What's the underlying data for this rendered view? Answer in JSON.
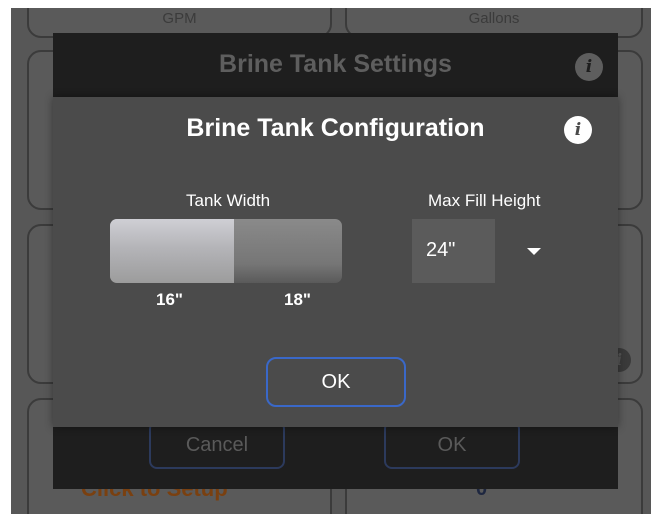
{
  "background": {
    "tiles": [
      {
        "label": "GPM"
      },
      {
        "label": "Gallons"
      }
    ],
    "setup_text": "Click to Setup",
    "value_text": "0"
  },
  "outer_dialog": {
    "title": "Brine Tank Settings",
    "info_icon": "info-icon",
    "cancel_label": "Cancel",
    "ok_label": "OK"
  },
  "inner_dialog": {
    "title": "Brine Tank Configuration",
    "info_icon": "info-icon",
    "tank_width": {
      "label": "Tank Width",
      "options": [
        "16\"",
        "18\""
      ],
      "selected": "16\""
    },
    "max_fill_height": {
      "label": "Max Fill Height",
      "value": "24\"",
      "dropdown_icon": "triangle-down-icon"
    },
    "ok_label": "OK"
  },
  "colors": {
    "accent_border": "#3a68c8",
    "dialog_bg": "#4b4b4b",
    "outer_dialog_bg": "#1e1e1e"
  }
}
